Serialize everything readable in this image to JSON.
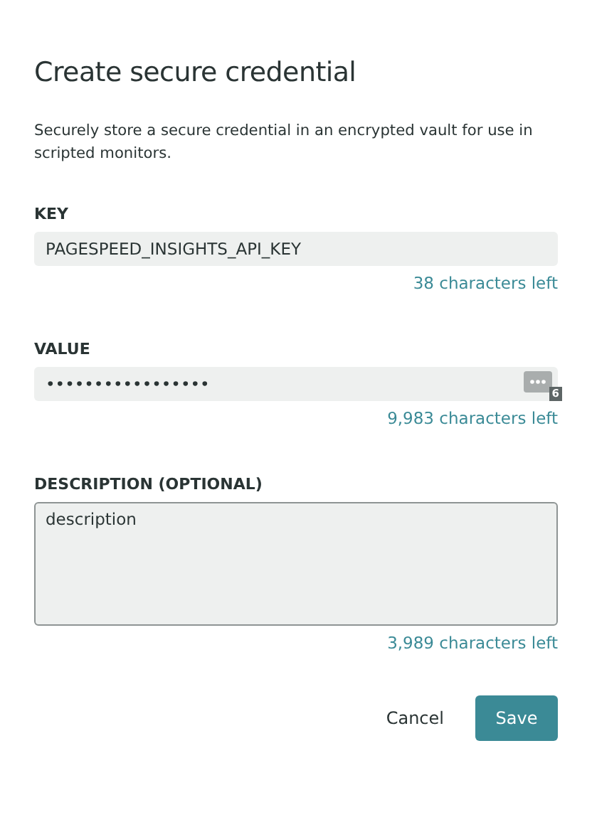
{
  "dialog": {
    "title": "Create secure credential",
    "description": "Securely store a secure credential in an encrypted vault for use in scripted monitors."
  },
  "fields": [
    {
      "kind": "text",
      "label": "KEY",
      "value": "PAGESPEED_INSIGHTS_API_KEY",
      "counter": "38 characters left"
    },
    {
      "kind": "secret",
      "label": "VALUE",
      "value": "•••••••••••••••••",
      "counter": "9,983 characters left",
      "badge": "6"
    },
    {
      "kind": "textarea",
      "label": "DESCRIPTION (OPTIONAL)",
      "value": "description",
      "counter": "3,989 characters left"
    }
  ],
  "buttons": [
    {
      "label": "Cancel",
      "kind": "secondary"
    },
    {
      "label": "Save",
      "kind": "primary"
    }
  ]
}
